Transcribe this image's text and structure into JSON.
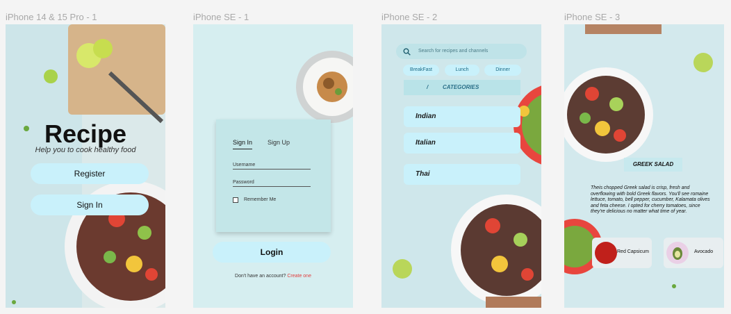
{
  "frames": {
    "f1": {
      "label": "iPhone 14 & 15 Pro - 1",
      "title": "Recipe",
      "subtitle": "Help you to cook healthy food",
      "register": "Register",
      "signin": "Sign In"
    },
    "f2": {
      "label": "iPhone SE - 1",
      "tab_signin": "Sign In",
      "tab_signup": "Sign Up",
      "username": "Username",
      "password": "Password",
      "remember": "Remember Me",
      "login": "Login",
      "footer_text": "Don't have an account?",
      "footer_link": "Create one"
    },
    "f3": {
      "label": "iPhone SE - 2",
      "search_placeholder": "Search for recipes and channels",
      "chips": [
        "BreakFast",
        "Lunch",
        "Dinner"
      ],
      "categories_title": "CATEGORIES",
      "categories": [
        "Indian",
        "Italian",
        "Thai"
      ]
    },
    "f4": {
      "label": "iPhone SE - 3",
      "dish": "GREEK SALAD",
      "description": "Theis chopped Greek salad is crisp, fresh and overflowing with bold Greek flavors. You'll see romaine lettuce,  tomato, bell pepper, cucumber, Kalamata olives and feta cheese. I opted for cherry tomatoes, since they're delicious no matter what time of year.",
      "ingredients": [
        "Red Capsicum",
        "Avocado"
      ]
    }
  },
  "colors": {
    "accent": "#c9f1fb",
    "link": "#e03d3d",
    "canvas": "#f4f4f4"
  },
  "icons": [
    "search-icon",
    "food-photo"
  ]
}
